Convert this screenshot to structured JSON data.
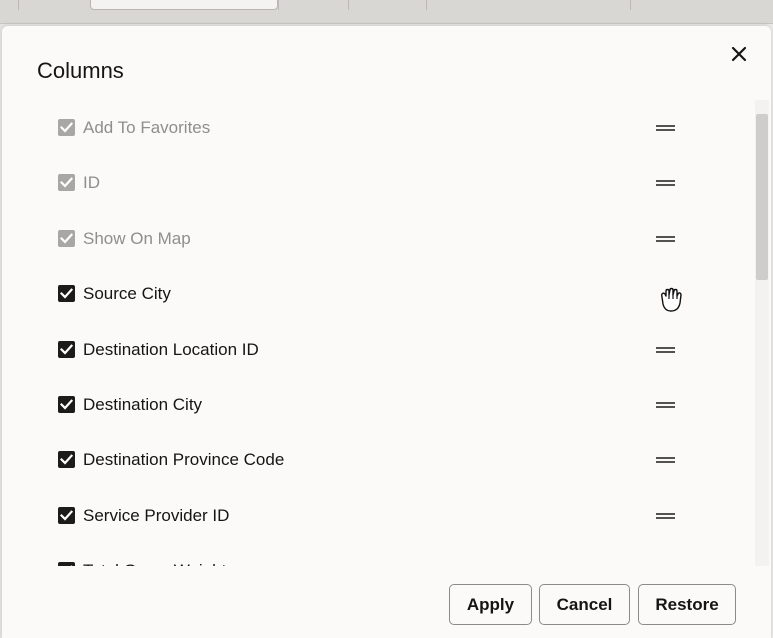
{
  "dialog": {
    "title": "Columns",
    "close_icon": "close-icon"
  },
  "columns": [
    {
      "label": "Add To Favorites",
      "checked": true,
      "disabled": true
    },
    {
      "label": "ID",
      "checked": true,
      "disabled": true
    },
    {
      "label": "Show On Map",
      "checked": true,
      "disabled": true
    },
    {
      "label": "Source City",
      "checked": true,
      "disabled": false
    },
    {
      "label": "Destination Location ID",
      "checked": true,
      "disabled": false
    },
    {
      "label": "Destination City",
      "checked": true,
      "disabled": false
    },
    {
      "label": "Destination Province Code",
      "checked": true,
      "disabled": false
    },
    {
      "label": "Service Provider ID",
      "checked": true,
      "disabled": false
    },
    {
      "label": "Total Gross Weight",
      "checked": true,
      "disabled": false
    }
  ],
  "footer": {
    "apply_label": "Apply",
    "cancel_label": "Cancel",
    "restore_label": "Restore"
  },
  "colors": {
    "checkbox_checked": "#1c1b19",
    "checkbox_disabled": "#a8a7a5",
    "text_disabled": "#8f8e8c",
    "dialog_background": "#fbfaf9"
  },
  "icons": {
    "drag_handle": "drag-handle-icon",
    "cursor": "grab-hand-cursor-icon",
    "checkmark": "checkmark-icon"
  }
}
